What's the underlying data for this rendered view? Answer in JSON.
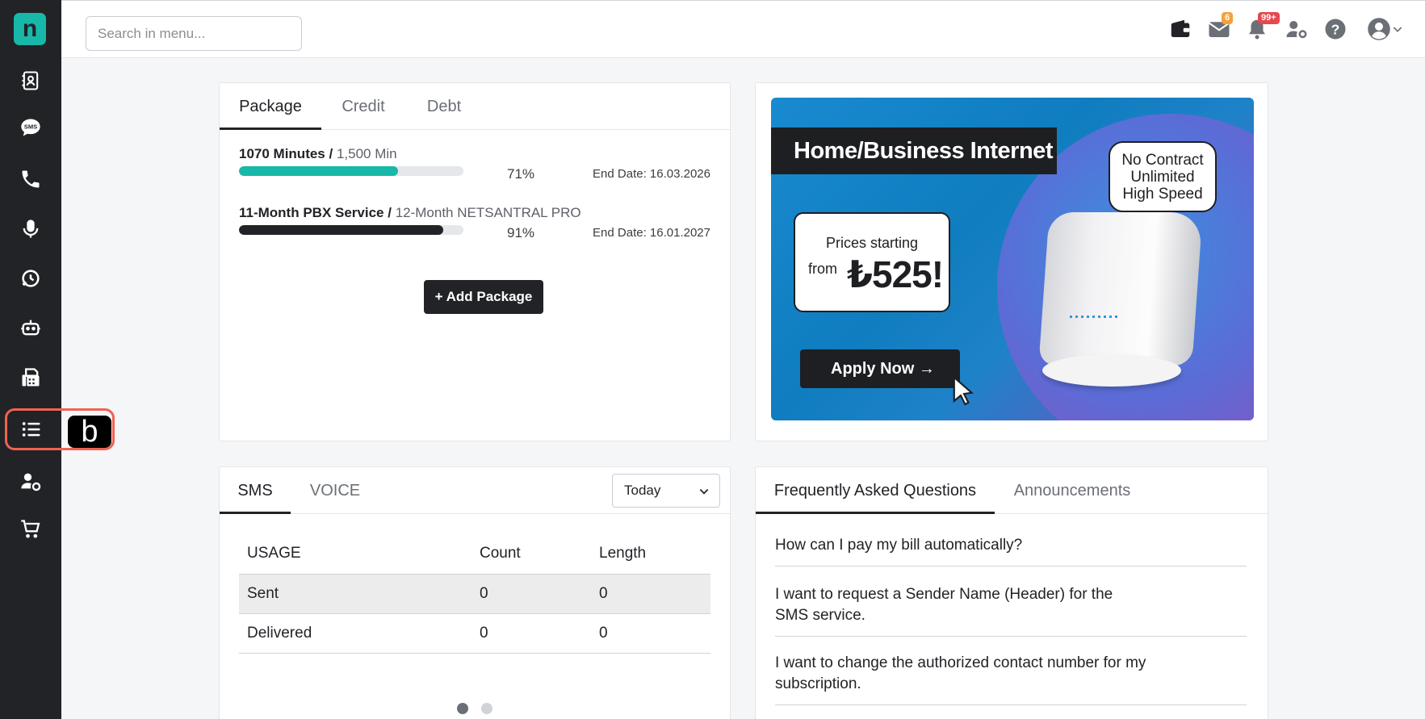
{
  "app": {
    "logo_letter": "n"
  },
  "sidebar": {
    "items": [
      {
        "name": "contacts-icon"
      },
      {
        "name": "sms-icon",
        "label": "SMS"
      },
      {
        "name": "phone-icon"
      },
      {
        "name": "microphone-icon"
      },
      {
        "name": "call-center-icon"
      },
      {
        "name": "robot-icon"
      },
      {
        "name": "fax-icon"
      },
      {
        "name": "list-icon"
      },
      {
        "name": "user-settings-icon"
      },
      {
        "name": "cart-icon"
      }
    ],
    "highlight_badge": "b"
  },
  "header": {
    "search_placeholder": "Search in menu...",
    "mail_count": "6",
    "notification_count": "99+"
  },
  "packages": {
    "tabs": [
      "Package",
      "Credit",
      "Debt"
    ],
    "active_tab": "Package",
    "items": [
      {
        "used": "1070 Minutes /",
        "total": "1,500 Min",
        "percent_label": "71%",
        "percent": 71,
        "end_date": "End Date: 16.03.2026",
        "bar_color": "#17b8a8"
      },
      {
        "used": "11-Month PBX Service /",
        "total": "12-Month NETSANTRAL PRO",
        "percent_label": "91%",
        "percent": 91,
        "end_date": "End Date: 16.01.2027",
        "bar_color": "#212327"
      }
    ],
    "add_button": "+ Add Package"
  },
  "banner": {
    "title": "Home/Business Internet",
    "price_line1": "Prices starting",
    "price_line2": "from",
    "price_value": "₺525!",
    "bubble_line1": "No Contract",
    "bubble_line2": "Unlimited",
    "bubble_line3": "High Speed",
    "apply_button": "Apply Now →"
  },
  "usage": {
    "tabs": [
      "SMS",
      "VOICE"
    ],
    "active_tab": "SMS",
    "period": "Today",
    "columns": [
      "USAGE",
      "Count",
      "Length"
    ],
    "rows": [
      {
        "label": "Sent",
        "count": "0",
        "length": "0"
      },
      {
        "label": "Delivered",
        "count": "0",
        "length": "0"
      }
    ]
  },
  "faq": {
    "tabs": [
      "Frequently Asked Questions",
      "Announcements"
    ],
    "active_tab": "Frequently Asked Questions",
    "items": [
      "How can I pay my bill automatically?",
      "I want to request a Sender Name (Header) for the SMS service.",
      "I want to change the authorized contact number for my subscription."
    ]
  }
}
